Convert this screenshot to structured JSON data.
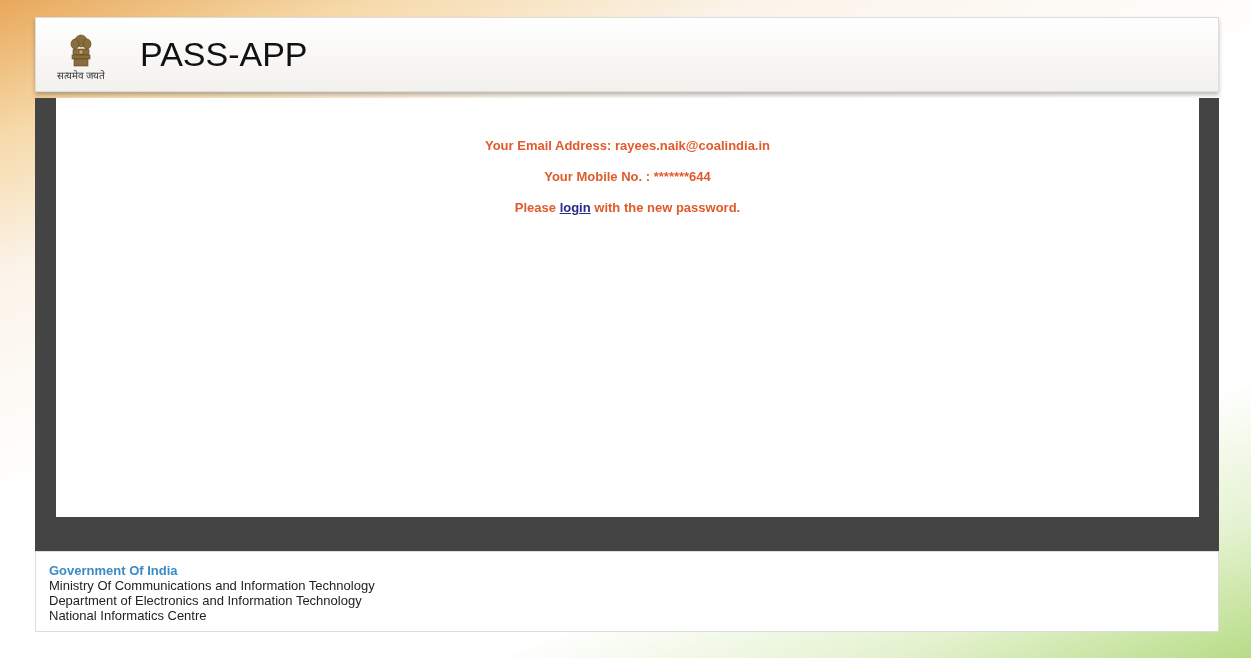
{
  "header": {
    "motto": "सत्यमेव जयते",
    "title": "PASS-APP"
  },
  "message": {
    "email_line": "Your Email Address: rayees.naik@coalindia.in",
    "mobile_line": "Your Mobile No. : *******644",
    "login_before": "Please ",
    "login_link": "login",
    "login_after": " with the new password."
  },
  "footer": {
    "heading": "Government Of India",
    "lines": [
      "Ministry Of Communications and Information Technology",
      "Department of Electronics and Information Technology",
      "National Informatics Centre"
    ]
  }
}
